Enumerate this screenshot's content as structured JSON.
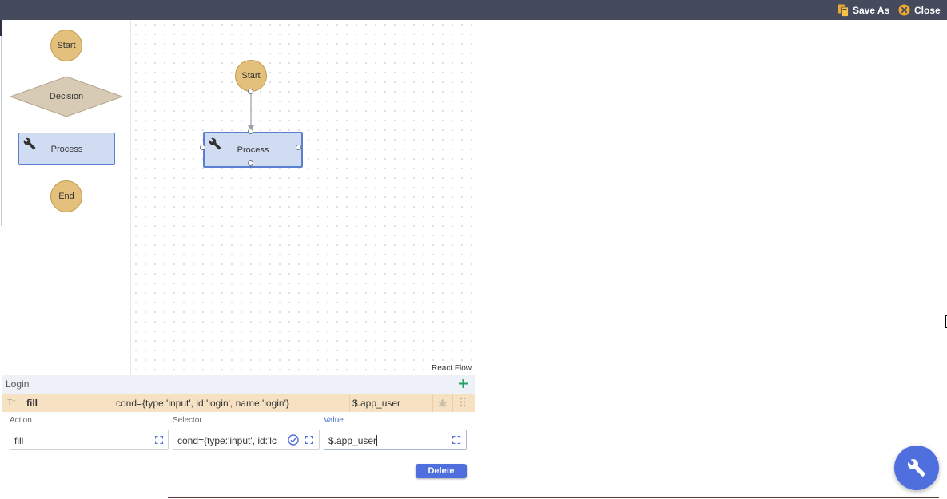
{
  "toolbar": {
    "save_as_label": "Save As",
    "close_label": "Close"
  },
  "palette": {
    "start_label": "Start",
    "decision_label": "Decision",
    "process_label": "Process",
    "end_label": "End"
  },
  "canvas": {
    "start_node_label": "Start",
    "process_node_label": "Process",
    "attribution": "React Flow"
  },
  "step_panel": {
    "title": "Login",
    "row": {
      "action": "fill",
      "selector": "cond={type:'input', id:'login', name:'login'}",
      "value": "$.app_user"
    },
    "form": {
      "action_label": "Action",
      "action_value": "fill",
      "selector_label": "Selector",
      "selector_value": "cond={type:'input', id:'lc",
      "value_label": "Value",
      "value_value": "$.app_user"
    },
    "delete_label": "Delete"
  },
  "icons": {
    "save_as": "save-as-icon",
    "close": "close-circle-icon",
    "process": "wrench-icon",
    "add": "plus-icon",
    "type": "text-format-icon",
    "debug": "bug-icon",
    "drag": "drag-handle-icon",
    "expand": "expand-icon",
    "validate": "check-circle-icon",
    "fab": "wrench-icon"
  },
  "colors": {
    "topbar": "#454b5d",
    "accent": "#4f6fde",
    "node_circle": "#e4c07d",
    "process_node": "#cfdcf2",
    "step_row": "#f6e2c2",
    "add_icon": "#21a366"
  }
}
